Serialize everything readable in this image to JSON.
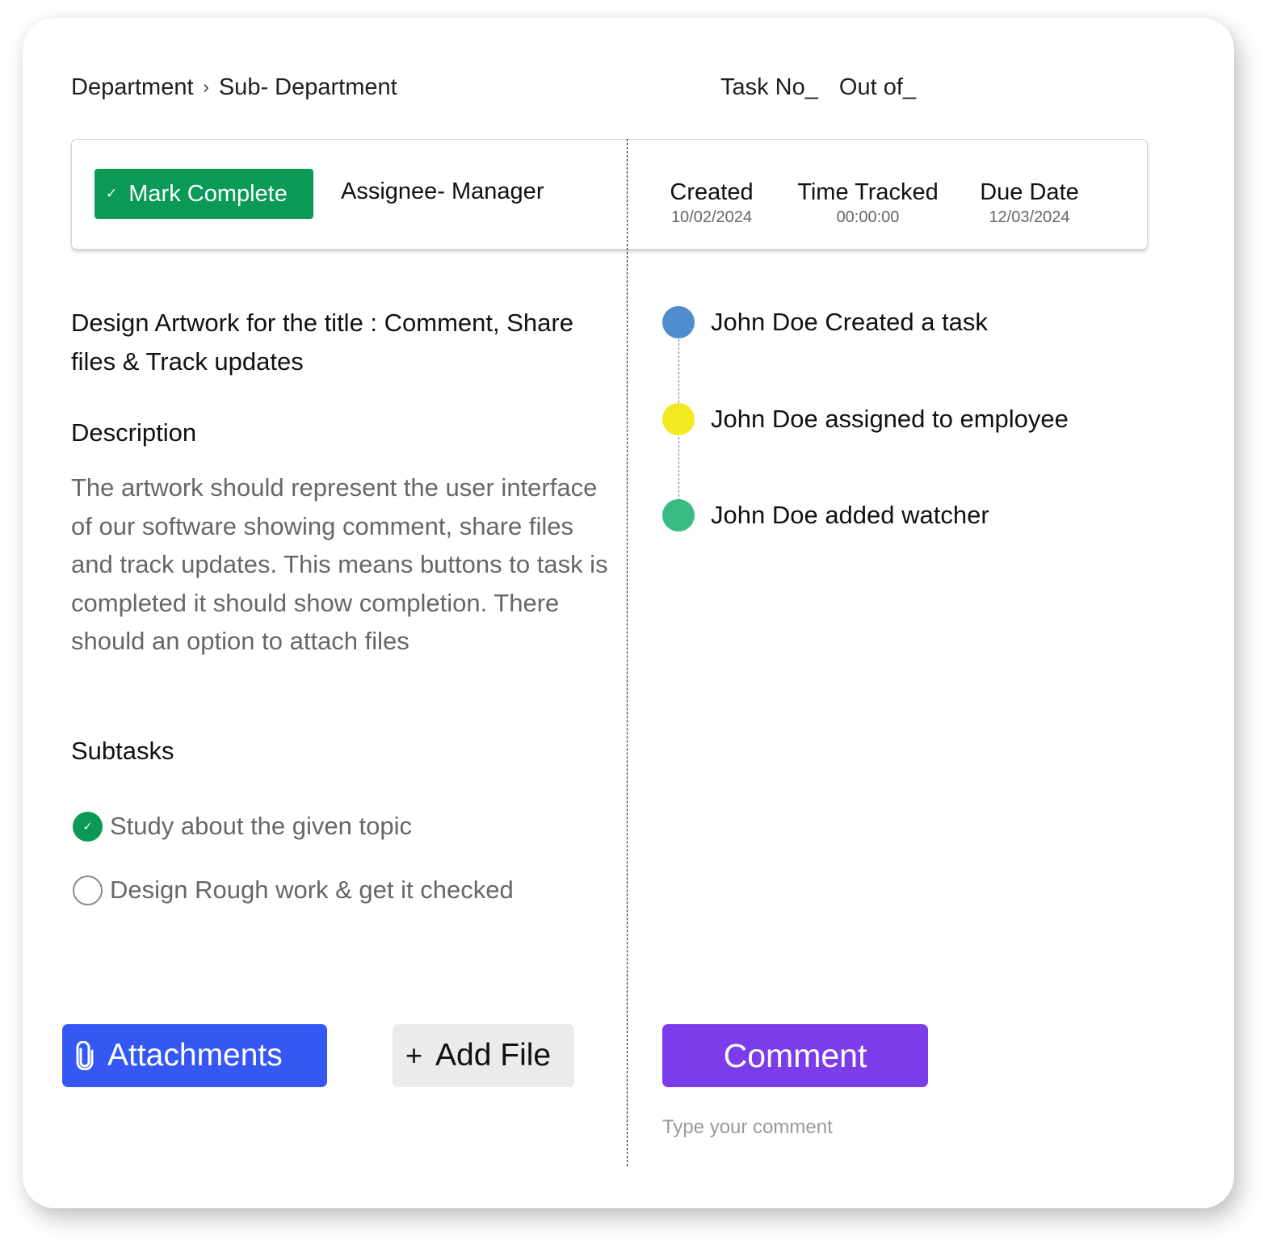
{
  "breadcrumb": {
    "items": [
      "Department",
      "Sub- Department"
    ],
    "separator": "›"
  },
  "task_position": {
    "task_no_label": "Task No_",
    "out_of_label": "Out of_"
  },
  "info_bar": {
    "mark_complete_label": "Mark Complete",
    "mark_complete_icon": "check-icon",
    "assignee": "Assignee- Manager",
    "created": {
      "label": "Created",
      "value": "10/02/2024"
    },
    "time_tracked": {
      "label": "Time Tracked",
      "value": "00:00:00"
    },
    "due_date": {
      "label": "Due Date",
      "value": "12/03/2024"
    }
  },
  "task": {
    "title": "Design Artwork for the title : Comment, Share files & Track updates",
    "description_heading": "Description",
    "description": "The artwork should represent the user interface of our software showing comment, share files and track updates. This means buttons to task is completed it should show completion. There should an option to attach files",
    "subtasks_heading": "Subtasks",
    "subtasks": [
      {
        "label": "Study about the given topic",
        "completed": true
      },
      {
        "label": "Design Rough work & get it checked",
        "completed": false
      }
    ]
  },
  "actions": {
    "attachments_label": "Attachments",
    "attachments_icon": "paperclip-icon",
    "add_file_label": "Add File",
    "add_file_icon": "plus-icon",
    "comment_label": "Comment",
    "comment_placeholder": "Type your comment"
  },
  "activity": [
    {
      "text": "John Doe Created a task",
      "color": "#518ccc"
    },
    {
      "text": "John Doe assigned to employee",
      "color": "#f2ea1e"
    },
    {
      "text": "John Doe added watcher",
      "color": "#37bb82"
    }
  ],
  "colors": {
    "success": "#0a9a55",
    "primary": "#3558f4",
    "accent": "#7b3cea",
    "neutral_button": "#ebebec"
  }
}
